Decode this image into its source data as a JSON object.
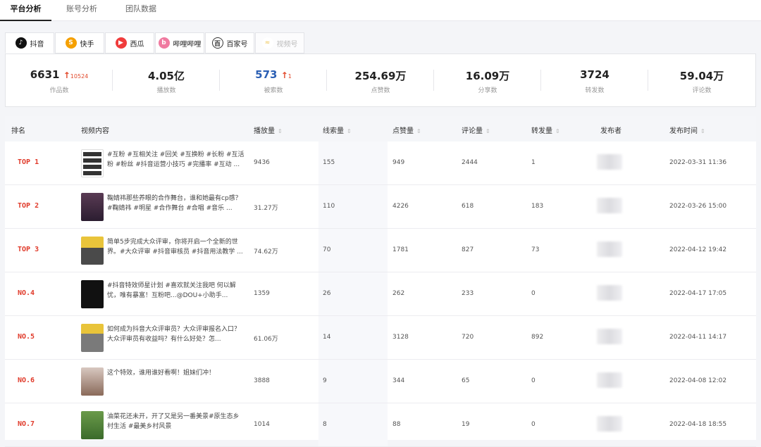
{
  "topnav": {
    "tabs": [
      "平台分析",
      "账号分析",
      "团队数据"
    ],
    "active": 0
  },
  "platforms": [
    {
      "label": "抖音",
      "icon": "douyin-icon",
      "glyph": "♪",
      "color": "#111111",
      "active": true
    },
    {
      "label": "快手",
      "icon": "kuaishou-icon",
      "glyph": "S",
      "color": "#f5a000"
    },
    {
      "label": "西瓜",
      "icon": "xigua-icon",
      "glyph": "▶",
      "color": "#f03c3c"
    },
    {
      "label": "哔哩哔哩",
      "icon": "bilibili-icon",
      "glyph": "b",
      "color": "#f07aa0"
    },
    {
      "label": "百家号",
      "icon": "baijiahao-icon",
      "glyph": "百",
      "color": "#333333"
    },
    {
      "label": "视频号",
      "icon": "shipinhao-icon",
      "glyph": "≈",
      "color": "#f2d27a",
      "disabled": true
    }
  ],
  "stats": [
    {
      "value": "6631",
      "up": "↑",
      "delta": "10524",
      "label": "作品数"
    },
    {
      "value": "4.05亿",
      "label": "播放数"
    },
    {
      "value": "573",
      "up": "↑",
      "delta": "1",
      "label": "被索数",
      "blue": true
    },
    {
      "value": "254.69万",
      "label": "点赞数"
    },
    {
      "value": "16.09万",
      "label": "分享数"
    },
    {
      "value": "3724",
      "label": "转发数"
    },
    {
      "value": "59.04万",
      "label": "评论数"
    }
  ],
  "table": {
    "headers": {
      "rank": "排名",
      "content": "视频内容",
      "plays": "播放量",
      "search": "线索量",
      "likes": "点赞量",
      "comments": "评论量",
      "shares": "转发量",
      "publisher": "发布者",
      "time": "发布时间"
    },
    "rows": [
      {
        "rank": "TOP 1",
        "desc": "#互粉 #互相关注 #回关 #互换粉 #长粉 #互活粉 #粉丝 #抖音运营小技巧 #完播率 #互动 ...",
        "plays": "9436",
        "search": "155",
        "likes": "949",
        "comments": "2444",
        "shares": "1",
        "time": "2022-03-31 11:36"
      },
      {
        "rank": "TOP 2",
        "desc": "鞠婧祎那些养眼的合作舞台，谁和她最有cp感？#鞠婧祎 #明星 #合作舞台 #合唱 #音乐 ...",
        "plays": "31.27万",
        "search": "110",
        "likes": "4226",
        "comments": "618",
        "shares": "183",
        "time": "2022-03-26 15:00"
      },
      {
        "rank": "TOP 3",
        "desc": "简单5步完成大众评审，你将开启一个全新的世界。#大众评审 #抖音审核员 #抖音用法教学 ...",
        "plays": "74.62万",
        "search": "70",
        "likes": "1781",
        "comments": "827",
        "shares": "73",
        "time": "2022-04-12 19:42"
      },
      {
        "rank": "NO.4",
        "desc": "#抖音特效师星计划 #喜欢就关注我吧 何以解忧，唯有暴富！互粉吧...@DOU+小助手...",
        "plays": "1359",
        "search": "26",
        "likes": "262",
        "comments": "233",
        "shares": "0",
        "time": "2022-04-17 17:05"
      },
      {
        "rank": "NO.5",
        "desc": "如何成为抖音大众评审员？大众评审报名入口？大众评审员有收益吗？有什么好处？怎...",
        "plays": "61.06万",
        "search": "14",
        "likes": "3128",
        "comments": "720",
        "shares": "892",
        "time": "2022-04-11 14:17"
      },
      {
        "rank": "NO.6",
        "desc": "这个特效，谁用谁好看啊！姐妹们冲！",
        "plays": "3888",
        "search": "9",
        "likes": "344",
        "comments": "65",
        "shares": "0",
        "time": "2022-04-08 12:02"
      },
      {
        "rank": "NO.7",
        "desc": "油菜花还未开，开了又是另一番美景#原生态乡村生活 #最美乡村风景",
        "plays": "1014",
        "search": "8",
        "likes": "88",
        "comments": "19",
        "shares": "0",
        "time": "2022-04-18 18:55"
      }
    ]
  },
  "sort_glyph": "⇕"
}
